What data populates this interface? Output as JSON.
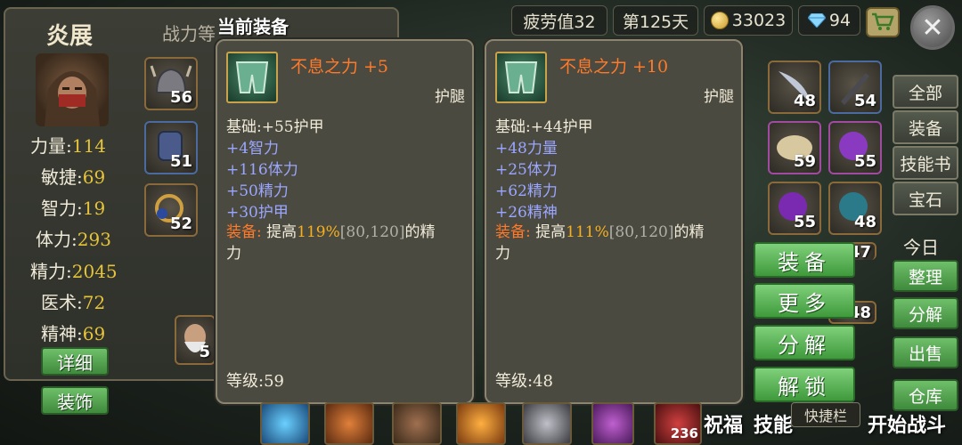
{
  "topbar": {
    "fatigue": "疲劳值32",
    "day": "第125天",
    "gold": "33023",
    "gems": "94"
  },
  "character": {
    "name": "炎展",
    "power_label": "战力等",
    "stats": [
      {
        "label": "力量:",
        "value": "114"
      },
      {
        "label": "敏捷:",
        "value": "69"
      },
      {
        "label": "智力:",
        "value": "19"
      },
      {
        "label": "体力:",
        "value": "293"
      },
      {
        "label": "精力:",
        "value": "2045"
      },
      {
        "label": "医术:",
        "value": "72"
      },
      {
        "label": "精神:",
        "value": "69"
      }
    ],
    "detail_button": "详细",
    "accessory_button": "装饰",
    "equip_slots": [
      "56",
      "51",
      "52"
    ],
    "companion_level": "5"
  },
  "current_title": "当前装备",
  "tooltips": [
    {
      "name": "不息之力",
      "plus": "+5",
      "slot_type": "护腿",
      "base": "基础:+55护甲",
      "bonuses": [
        "+4智力",
        "+116体力",
        "+50精力",
        "+30护甲"
      ],
      "equip_label": "装备:",
      "equip_text_1": "提高",
      "equip_pct": "119%",
      "equip_range": "[80,120]",
      "equip_text_2": "的精",
      "equip_text_3": "力",
      "level": "等级:59"
    },
    {
      "name": "不息之力",
      "plus": "+10",
      "slot_type": "护腿",
      "base": "基础:+44护甲",
      "bonuses": [
        "+48力量",
        "+25体力",
        "+62精力",
        "+26精神"
      ],
      "equip_label": "装备:",
      "equip_text_1": "提高",
      "equip_pct": "111%",
      "equip_range": "[80,120]",
      "equip_text_2": "的精",
      "equip_text_3": "力",
      "level": "等级:48"
    }
  ],
  "actions": {
    "equip": "装备",
    "more": "更多",
    "decompose": "分解",
    "unlock": "解锁"
  },
  "side_tabs": [
    "全部",
    "装备",
    "技能书",
    "宝石"
  ],
  "today": "今日",
  "side_actions": [
    "整理",
    "分解",
    "出售",
    "仓库"
  ],
  "inventory_counts": [
    "48",
    "54",
    "59",
    "55",
    "55",
    "48",
    "47",
    "48"
  ],
  "bottom": {
    "quick_bar": "快捷栏",
    "count": "236",
    "blessing": "祝福",
    "skill": "技能",
    "start_battle": "开始战斗"
  }
}
